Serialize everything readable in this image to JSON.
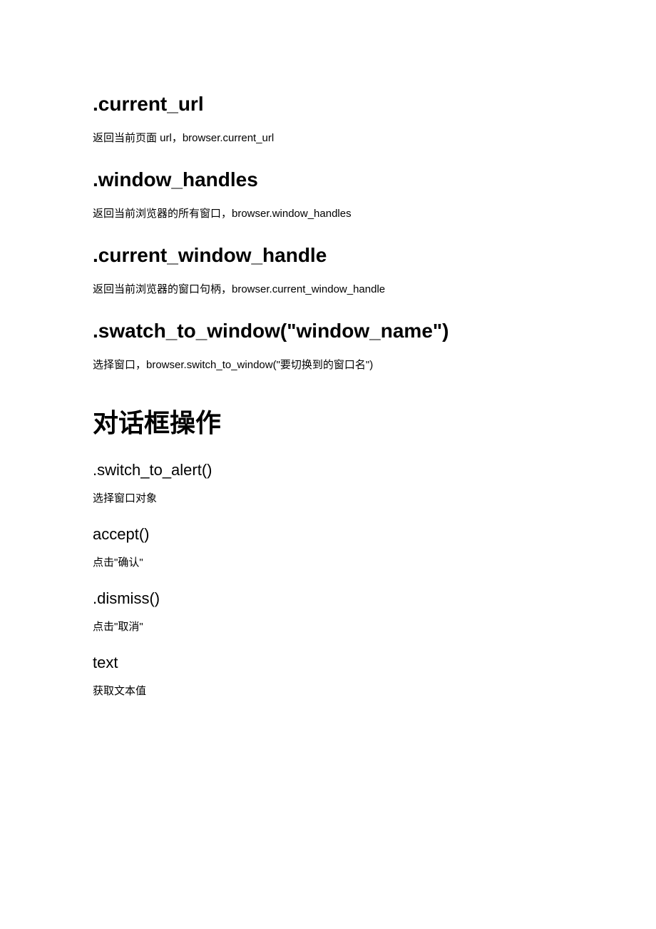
{
  "sections": [
    {
      "type": "h2",
      "text": ".current_url"
    },
    {
      "type": "p",
      "text": "返回当前页面 url，browser.current_url"
    },
    {
      "type": "h2",
      "text": ".window_handles"
    },
    {
      "type": "p",
      "text": "返回当前浏览器的所有窗口，browser.window_handles"
    },
    {
      "type": "h2",
      "text": ".current_window_handle"
    },
    {
      "type": "p",
      "text": "返回当前浏览器的窗口句柄，browser.current_window_handle"
    },
    {
      "type": "h2",
      "text": ".swatch_to_window(\"window_name\")"
    },
    {
      "type": "p",
      "text": "选择窗口，browser.switch_to_window(\"要切换到的窗口名\")"
    },
    {
      "type": "h1",
      "text": "对话框操作"
    },
    {
      "type": "h3",
      "text": " .switch_to_alert()"
    },
    {
      "type": "p",
      "text": "选择窗口对象"
    },
    {
      "type": "h3",
      "text": "accept()"
    },
    {
      "type": "p",
      "text": "点击\"确认\""
    },
    {
      "type": "h3",
      "text": ".dismiss()"
    },
    {
      "type": "p",
      "text": "点击\"取消\""
    },
    {
      "type": "h3",
      "text": "text"
    },
    {
      "type": "p",
      "text": "获取文本值"
    }
  ]
}
